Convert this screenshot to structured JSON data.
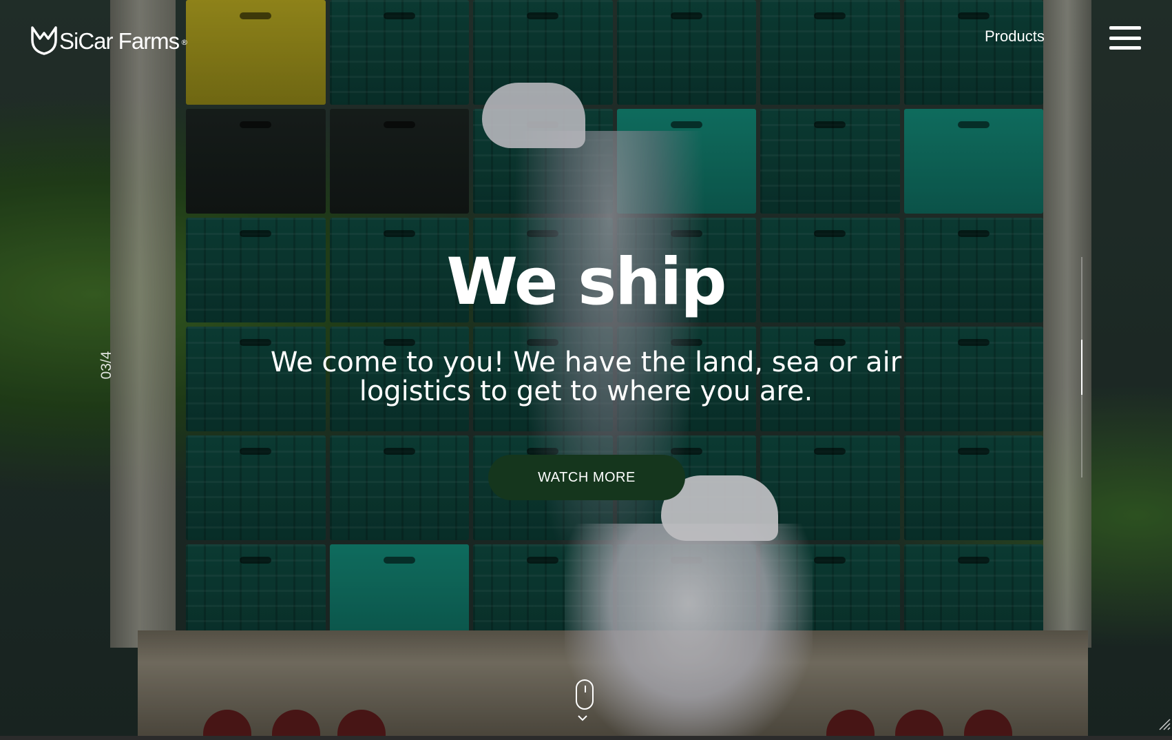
{
  "brand": {
    "name": "SiCar Farms",
    "registered_mark": "®"
  },
  "nav": {
    "products_label": "Products",
    "menu_icon": "hamburger-menu-icon"
  },
  "hero": {
    "title": "We ship",
    "subtitle": "We come to you! We have the land, sea or air logistics to get to where you are.",
    "cta_label": "WATCH MORE",
    "cta_color": "#15361d"
  },
  "slider": {
    "counter": "03/4",
    "current": 3,
    "total": 4
  },
  "scroll": {
    "icon": "mouse-scroll-icon"
  }
}
